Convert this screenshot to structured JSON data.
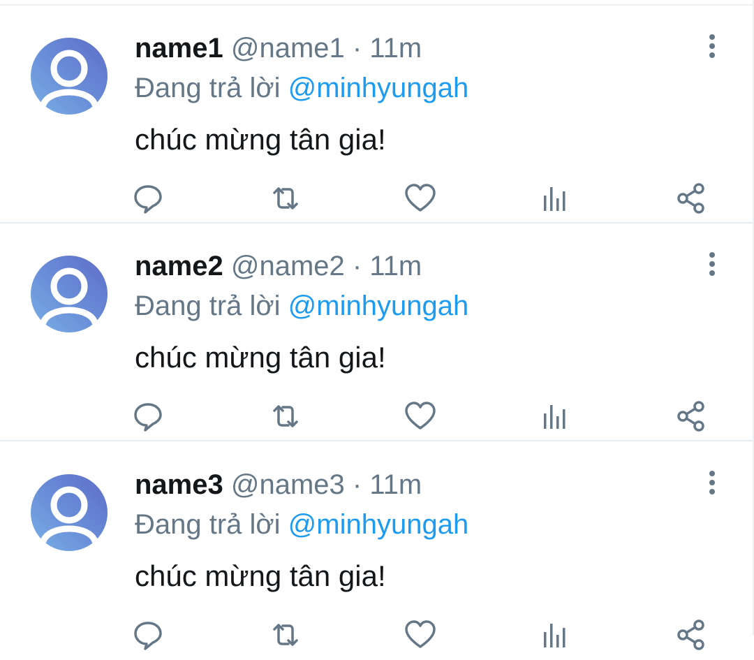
{
  "feed": {
    "tweets": [
      {
        "display_name": "name1",
        "handle": "@name1",
        "separator": "·",
        "time": "11m",
        "reply_prefix": "Đang trả lời",
        "reply_to": "@minhyungah",
        "text": "chúc mừng tân gia!"
      },
      {
        "display_name": "name2",
        "handle": "@name2",
        "separator": "·",
        "time": "11m",
        "reply_prefix": "Đang trả lời",
        "reply_to": "@minhyungah",
        "text": "chúc mừng tân gia!"
      },
      {
        "display_name": "name3",
        "handle": "@name3",
        "separator": "·",
        "time": "11m",
        "reply_prefix": "Đang trả lời",
        "reply_to": "@minhyungah",
        "text": "chúc mừng tân gia!"
      }
    ]
  },
  "icons": {
    "avatar": "default-avatar-icon",
    "more": "more-vertical-icon",
    "reply": "reply-bubble-icon",
    "retweet": "retweet-icon",
    "like": "heart-icon",
    "analytics": "analytics-bars-icon",
    "share": "share-icon"
  },
  "colors": {
    "text_primary": "#14171a",
    "text_secondary": "#657786",
    "mention": "#1d9bf0",
    "icon": "#657786",
    "divider": "#e6ecf0"
  }
}
